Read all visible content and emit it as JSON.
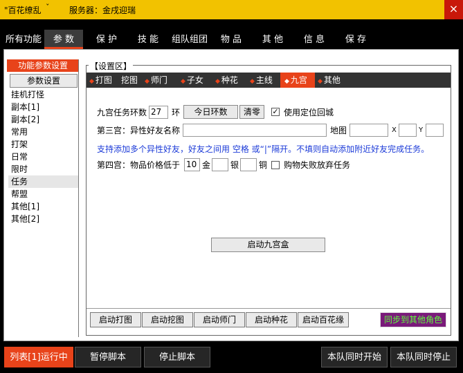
{
  "window": {
    "title": "\"百花缭乱",
    "chevron": "ˇ",
    "server_text": "服务器：金戌迎瑞",
    "close_glyph": "×"
  },
  "main_tabs": [
    {
      "label": "所有功能",
      "active": false
    },
    {
      "label": "参 数",
      "active": true
    },
    {
      "label": "保 护",
      "active": false
    },
    {
      "label": "技 能",
      "active": false
    },
    {
      "label": "组队组团",
      "active": false
    },
    {
      "label": "物 品",
      "active": false
    },
    {
      "label": "其 他",
      "active": false
    },
    {
      "label": "信 息",
      "active": false
    },
    {
      "label": "保 存",
      "active": false
    }
  ],
  "sidebar": {
    "header": "功能参数设置",
    "button": "参数设置",
    "items": [
      {
        "label": "挂机打怪",
        "active": false
      },
      {
        "label": "副本[1]",
        "active": false
      },
      {
        "label": "副本[2]",
        "active": false
      },
      {
        "label": "常用",
        "active": false
      },
      {
        "label": "打架",
        "active": false
      },
      {
        "label": "日常",
        "active": false
      },
      {
        "label": "限时",
        "active": false
      },
      {
        "label": "任务",
        "active": true
      },
      {
        "label": "帮盟",
        "active": false
      },
      {
        "label": "其他[1]",
        "active": false
      },
      {
        "label": "其他[2]",
        "active": false
      }
    ]
  },
  "settings": {
    "legend": "【设置区】",
    "subtabs": [
      {
        "label": "打图",
        "dot": true,
        "active": false
      },
      {
        "label": "挖图",
        "dot": false,
        "active": false
      },
      {
        "label": "师门",
        "dot": true,
        "active": false
      },
      {
        "label": "子女",
        "dot": true,
        "active": false
      },
      {
        "label": "种花",
        "dot": true,
        "active": false
      },
      {
        "label": "主线",
        "dot": true,
        "active": false
      },
      {
        "label": "九宫",
        "dot": true,
        "active": true
      },
      {
        "label": "其他",
        "dot": true,
        "active": false
      }
    ],
    "row1": {
      "label": "九宫任务环数",
      "rings_value": "27",
      "ring_unit": "环",
      "today_btn": "今日环数",
      "clear_btn": "清零",
      "checkbox_checked": true,
      "checkbox_mark": "✓",
      "checkbox_label": "使用定位回城"
    },
    "row2": {
      "label": "第三宫：异性好友名称",
      "friend_value": "",
      "map_label": "地图",
      "map_value": "",
      "x_label": "X",
      "x_value": "",
      "y_label": "Y",
      "y_value": ""
    },
    "hint": "支持添加多个异性好友，好友之间用 空格 或“|”隔开。不填则自动添加附近好友完成任务。",
    "row4": {
      "label": "第四宫：物品价格低于",
      "gold_value": "10",
      "gold_unit": "金",
      "silver_value": "",
      "silver_unit": "银",
      "copper_value": "",
      "copper_unit": "铜",
      "checkbox_checked": false,
      "checkbox_label": "购物失败放弃任务"
    },
    "start_button": "启动九宫盒"
  },
  "bottom_buttons": [
    "启动打图",
    "启动挖图",
    "启动师门",
    "启动种花",
    "启动百花缘"
  ],
  "sync_button": "同步到其他角色",
  "footer": {
    "run_list": "列表[1]运行中",
    "pause": "暂停脚本",
    "stop": "停止脚本",
    "team_start": "本队同时开始",
    "team_stop": "本队同时停止"
  },
  "colors": {
    "title_bar": "#f2c200",
    "accent": "#e8431a",
    "close": "#c8180a",
    "hint_text": "#1c3bd8",
    "sync_bg": "#7a1a7a",
    "sync_text": "#5dff3a"
  }
}
